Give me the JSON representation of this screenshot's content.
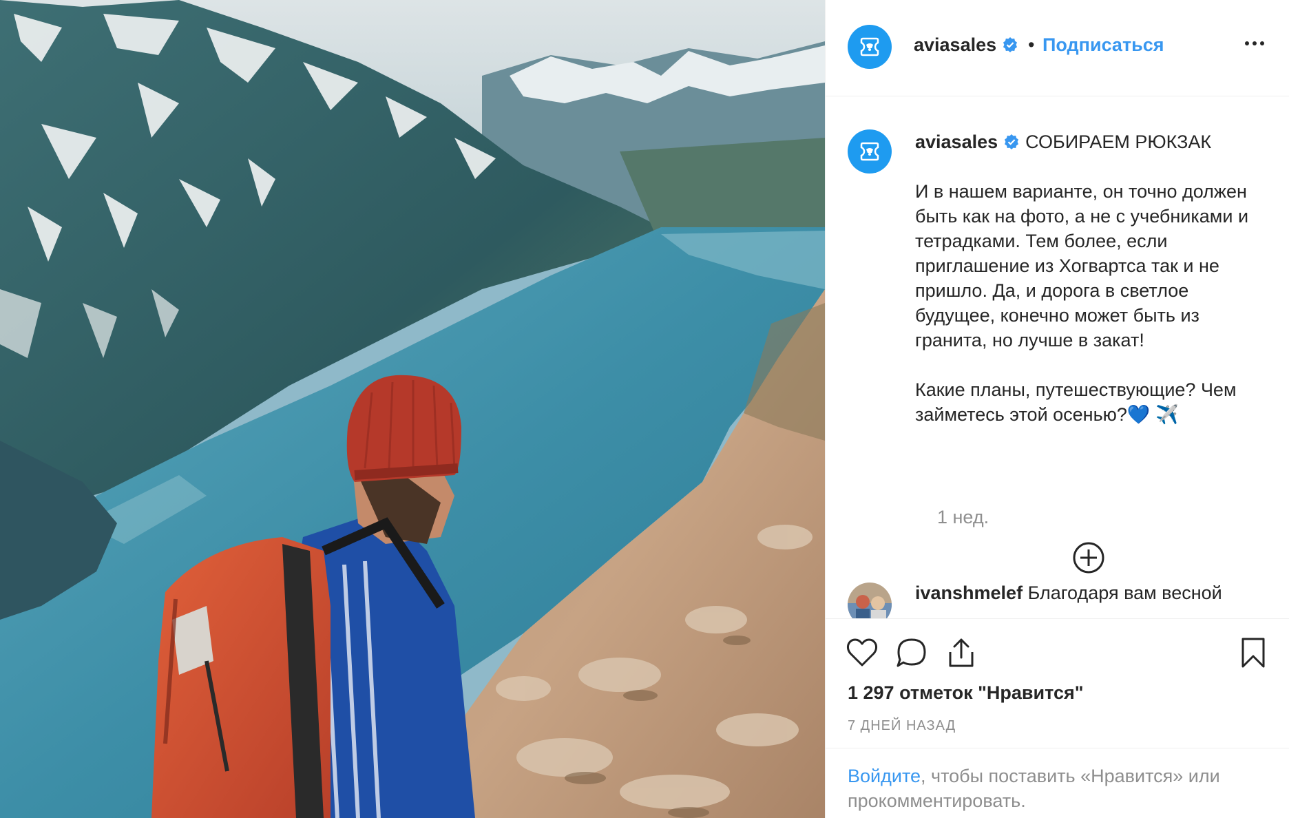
{
  "post": {
    "username": "aviasales",
    "follow_label": "Подписаться",
    "separator": "•",
    "photo_icon": "mountain-lake-hiker-photo"
  },
  "caption": {
    "username": "aviasales",
    "title": "СОБИРАЕМ РЮКЗАК",
    "paragraph1": "И в нашем варианте, он точно должен быть как на фото, а не с учебниками и тетрадками. Тем более, если приглашение из Хогвартса так и не пришло. Да, и дорога в светлое будущее, конечно может быть из гранита, но лучше в закат!",
    "paragraph2": "Какие планы, путешествующие? Чем займетесь этой осенью?💙 ✈️",
    "time_ago": "1 нед."
  },
  "comment": {
    "username": "ivanshmelef",
    "text": "Благодаря вам весной"
  },
  "actions": {
    "likes": "1 297 отметок \"Нравится\"",
    "date": "7 ДНЕЙ НАЗАД"
  },
  "login": {
    "link": "Войдите",
    "rest": ", чтобы поставить «Нравится» или прокомментировать."
  },
  "colors": {
    "accent": "#3897f0",
    "brand_avatar": "#1e9bf0",
    "muted_text": "#8e8e8e",
    "divider": "#efefef"
  }
}
